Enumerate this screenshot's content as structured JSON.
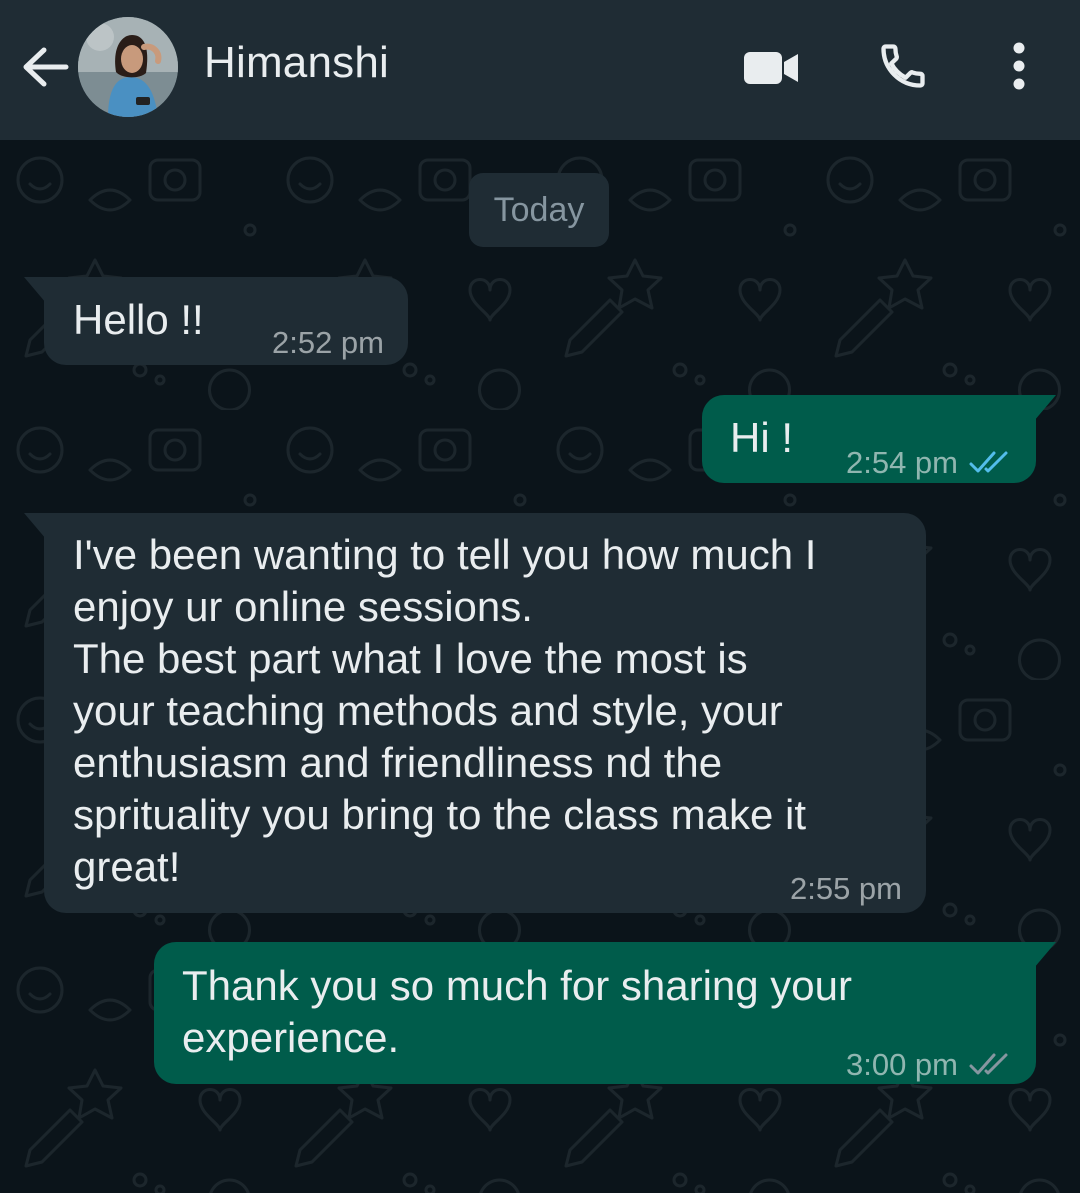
{
  "header": {
    "contact_name": "Himanshi",
    "back_icon": "arrow-left-icon",
    "video_icon": "video-camera-icon",
    "call_icon": "phone-icon",
    "more_icon": "more-vertical-icon",
    "background_color": "#1f2c34"
  },
  "chat": {
    "date_chip": "Today",
    "background_color": "#0b141a",
    "messages": [
      {
        "direction": "incoming",
        "text": "Hello !!",
        "time": "2:52 pm"
      },
      {
        "direction": "outgoing",
        "text": "Hi !",
        "time": "2:54 pm",
        "status": "read",
        "status_icon": "double-check-icon",
        "status_color": "#53bdeb"
      },
      {
        "direction": "incoming",
        "text": "I've been wanting to tell you how much I\nenjoy ur online sessions.\nThe best part what I love the most is\nyour teaching methods and style, your\nenthusiasm and friendliness nd the\nsprituality you bring to the class make it\ngreat!",
        "time": "2:55 pm"
      },
      {
        "direction": "outgoing",
        "text": "Thank you so much for sharing your\nexperience.",
        "time": "3:00 pm",
        "status": "delivered",
        "status_icon": "double-check-icon",
        "status_color": "#8696a0"
      }
    ]
  },
  "colors": {
    "incoming_bubble": "#1f2c34",
    "outgoing_bubble": "#005c4b",
    "primary_text": "#e9edef",
    "secondary_text": "#8696a0"
  }
}
